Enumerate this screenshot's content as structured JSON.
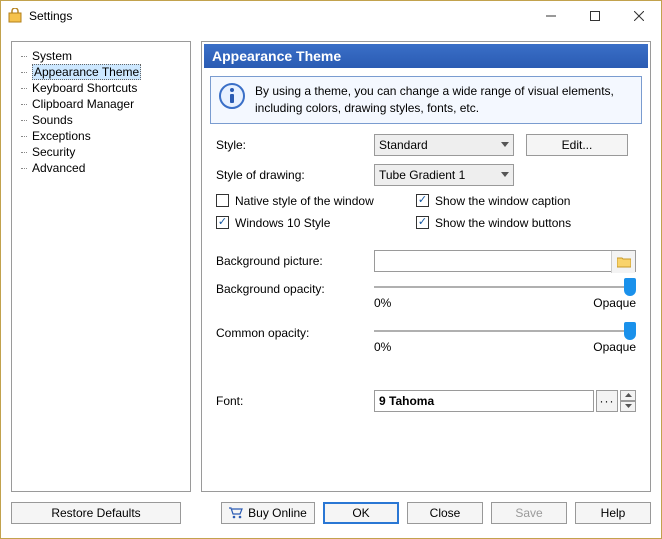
{
  "window": {
    "title": "Settings"
  },
  "sidebar": {
    "items": [
      {
        "label": "System"
      },
      {
        "label": "Appearance Theme"
      },
      {
        "label": "Keyboard Shortcuts"
      },
      {
        "label": "Clipboard Manager"
      },
      {
        "label": "Sounds"
      },
      {
        "label": "Exceptions"
      },
      {
        "label": "Security"
      },
      {
        "label": "Advanced"
      }
    ],
    "selectedIndex": 1
  },
  "header": {
    "title": "Appearance Theme"
  },
  "info": {
    "text": "By using a theme, you can change a wide range of visual elements, including colors, drawing styles, fonts, etc."
  },
  "form": {
    "style_label": "Style:",
    "style_value": "Standard",
    "edit_label": "Edit...",
    "drawing_label": "Style of drawing:",
    "drawing_value": "Tube Gradient 1",
    "native_label": "Native style of the window",
    "native_checked": false,
    "win10_label": "Windows 10 Style",
    "win10_checked": true,
    "show_caption_label": "Show the window caption",
    "show_caption_checked": true,
    "show_buttons_label": "Show the window buttons",
    "show_buttons_checked": true,
    "bgpic_label": "Background picture:",
    "bgpic_value": "",
    "bgopacity_label": "Background opacity:",
    "common_opacity_label": "Common opacity:",
    "slider_min": "0%",
    "slider_max": "Opaque",
    "font_label": "Font:",
    "font_value": "9 Tahoma"
  },
  "footer": {
    "restore": "Restore Defaults",
    "buy": "Buy Online",
    "ok": "OK",
    "close": "Close",
    "save": "Save",
    "help": "Help"
  }
}
